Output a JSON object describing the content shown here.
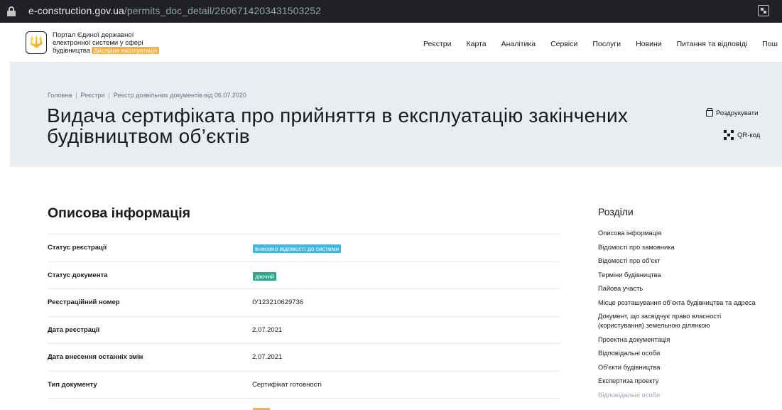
{
  "browser": {
    "url_host": "e-construction.gov.ua",
    "url_path": "/permits_doc_detail/2606714203431503252"
  },
  "header": {
    "logo_line1": "Портал Єдиної державної",
    "logo_line2": "електронної системи у сфері",
    "logo_line3": "будівництва",
    "trial_badge": "Дослідна експлуатація",
    "nav": [
      "Реєстри",
      "Карта",
      "Аналітика",
      "Сервіси",
      "Послуги",
      "Новини",
      "Питання та відповіді",
      "Пош"
    ]
  },
  "hero": {
    "breadcrumbs": [
      "Головна",
      "Реєстри",
      "Реєстр дозвільних документів від 06.07.2020"
    ],
    "title": "Видача сертифіката про прийняття в експлуатацію закінчених будівництвом об’єктів",
    "print_label": "Роздрукувати",
    "qr_label": "QR-код"
  },
  "main": {
    "section_title": "Описова інформація",
    "rows": [
      {
        "label": "Статус реєстрації",
        "value": "внесено відомості до системи",
        "chip": "blue"
      },
      {
        "label": "Статус документа",
        "value": "діючий",
        "chip": "green"
      },
      {
        "label": "Реєстраційний номер",
        "value": "ІУ123210629736"
      },
      {
        "label": "Дата реєстрації",
        "value": "2.07.2021"
      },
      {
        "label": "Дата внесення останніх змін",
        "value": "2.07.2021"
      },
      {
        "label": "Тип документу",
        "value": "Сертифікат готовності"
      }
    ]
  },
  "sidebar": {
    "title": "Розділи",
    "items": [
      "Описова інформація",
      "Відомості про замовника",
      "Відомості про об’єкт",
      "Терміни будівництва",
      "Пайова участь",
      "Місце розташування об’єкта будівництва та адреса",
      "Документ, що засвідчує право власності (користування) земельною ділянкою",
      "Проектна документація",
      "Відповідальні особи",
      "Об’єкти будівництва",
      "Експертиза проекту",
      "Відповідальні особи"
    ]
  },
  "colors": {
    "hero_bg": "#e8edf2",
    "chip_blue": "#41b7e0",
    "chip_green": "#2fa58a",
    "trial_badge": "#f0b14b"
  }
}
